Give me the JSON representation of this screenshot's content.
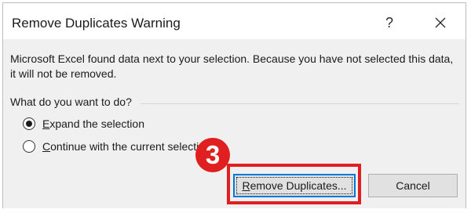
{
  "dialog": {
    "title": "Remove Duplicates Warning",
    "help_label": "?",
    "close_icon": "close-icon"
  },
  "message": "Microsoft Excel found data next to your selection. Because you have not selected this data, it will not be removed.",
  "question": "What do you want to do?",
  "options": [
    {
      "mnemonic": "E",
      "label_rest": "xpand the selection",
      "selected": true
    },
    {
      "mnemonic": "C",
      "label_rest": "ontinue with the current selection",
      "selected": false
    }
  ],
  "buttons": {
    "primary": {
      "mnemonic": "R",
      "label_rest": "emove Duplicates..."
    },
    "cancel": {
      "label": "Cancel"
    }
  },
  "annotation": {
    "step_number": "3",
    "color": "#e02020"
  },
  "colors": {
    "focus_blue": "#0078d7",
    "content_bg": "#f0f0f0"
  }
}
